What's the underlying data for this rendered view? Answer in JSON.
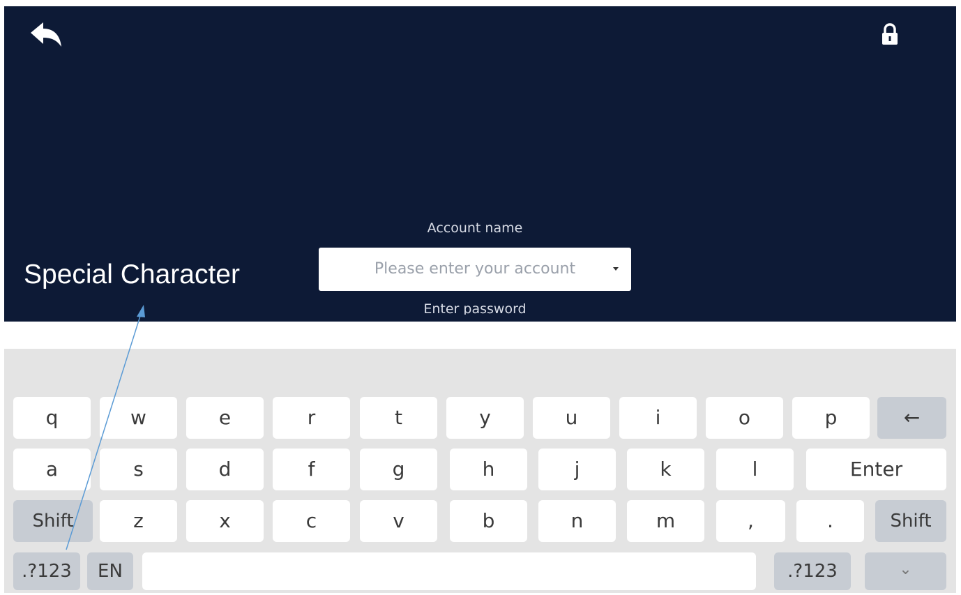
{
  "header": {
    "back_icon": "back-arrow-icon",
    "lock_icon": "lock-icon"
  },
  "login": {
    "account_label": "Account name",
    "account_placeholder": "Please enter your account",
    "password_label": "Enter password"
  },
  "annotation": {
    "label": "Special Character"
  },
  "keyboard": {
    "row1": [
      "q",
      "w",
      "e",
      "r",
      "t",
      "y",
      "u",
      "i",
      "o",
      "p"
    ],
    "backspace": "←",
    "row2": [
      "a",
      "s",
      "d",
      "f",
      "g",
      "h",
      "j",
      "k",
      "l"
    ],
    "enter": "Enter",
    "shift_left": "Shift",
    "row3": [
      "z",
      "x",
      "c",
      "v",
      "b",
      "n",
      "m",
      ",",
      "."
    ],
    "shift_right": "Shift",
    "symbols_left": ".?123",
    "lang": "EN",
    "space": "",
    "symbols_right": ".?123",
    "hide": "⌄"
  },
  "colors": {
    "panel_bg": "#0d1a36",
    "keyboard_bg": "#e4e4e4",
    "mod_key": "#c7ccd3",
    "annotation_arrow": "#5b9bd5"
  }
}
